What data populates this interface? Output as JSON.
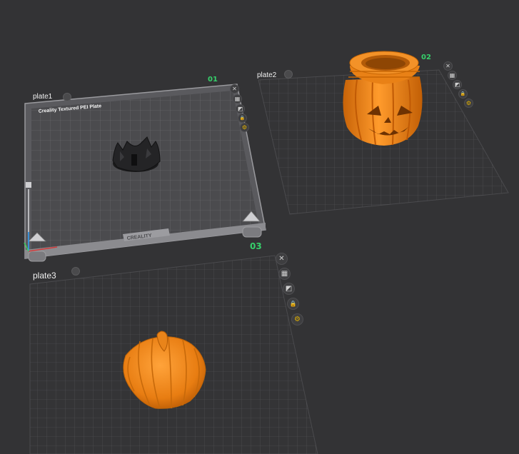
{
  "plates": [
    {
      "label": "plate1",
      "number": "01",
      "bed_text": "Creality Textured PEI Plate",
      "brand": "CREALITY"
    },
    {
      "label": "plate2",
      "number": "02"
    },
    {
      "label": "plate3",
      "number": "03"
    }
  ],
  "plate_tools": [
    "close-icon",
    "arrange-icon",
    "orient-icon",
    "lock-icon",
    "settings-gear-icon"
  ],
  "icons": {
    "close": "✕",
    "arrange": "▦",
    "orient": "◩",
    "lock": "🔒",
    "gear": "⚙",
    "plate_lock": "⊘"
  },
  "colors": {
    "background": "#333335",
    "plate_number": "#36d06b",
    "pumpkin": "#f08a1c",
    "bed_frame": "#8e8e92",
    "bed_surface": "#4d4d50",
    "gear": "#e0b000"
  }
}
